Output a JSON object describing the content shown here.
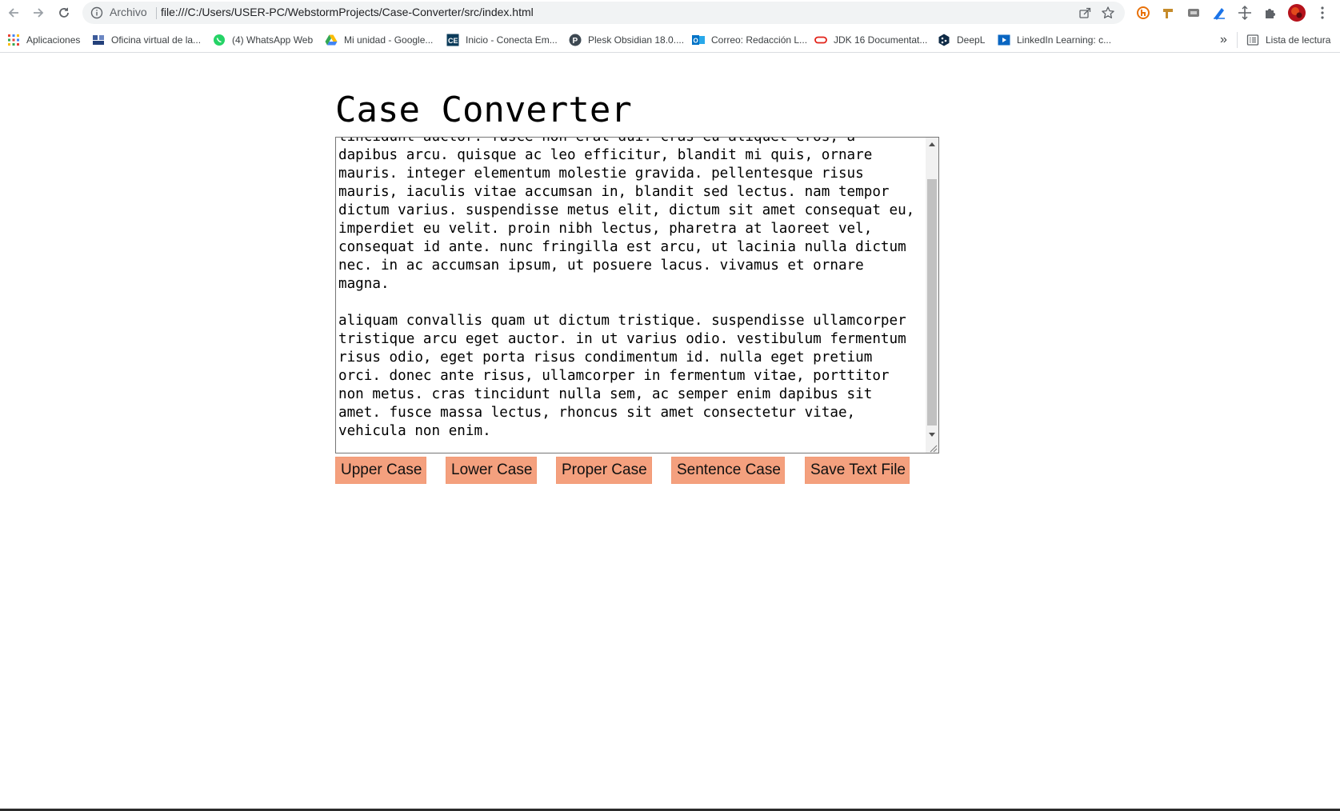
{
  "browser": {
    "scheme_label": "Archivo",
    "url": "file:///C:/Users/USER-PC/WebstormProjects/Case-Converter/src/index.html",
    "icons": [
      "back-icon",
      "forward-icon",
      "reload-icon",
      "info-icon",
      "share-icon",
      "star-icon",
      "extension-icons",
      "puzzle-icon",
      "profile-avatar",
      "menu-dots-icon"
    ]
  },
  "bookmarks": {
    "items": [
      {
        "label": "Aplicaciones",
        "icon": "apps-grid-icon"
      },
      {
        "label": "Oficina virtual de la...",
        "icon": "office-icon"
      },
      {
        "label": "(4) WhatsApp Web",
        "icon": "whatsapp-icon"
      },
      {
        "label": "Mi unidad - Google...",
        "icon": "google-drive-icon"
      },
      {
        "label": "Inicio - Conecta Em...",
        "icon": "ce-icon"
      },
      {
        "label": "Plesk Obsidian 18.0....",
        "icon": "plesk-icon"
      },
      {
        "label": "Correo: Redacción L...",
        "icon": "outlook-icon"
      },
      {
        "label": "JDK 16 Documentat...",
        "icon": "oracle-icon"
      },
      {
        "label": "DeepL",
        "icon": "deepl-icon"
      },
      {
        "label": "LinkedIn Learning: c...",
        "icon": "linkedin-learning-icon"
      }
    ],
    "overflow_label": "»",
    "reading_list_label": "Lista de lectura"
  },
  "page": {
    "title": "Case Converter",
    "text_content": "tincidunt auctor. fusce non erat dui. cras eu aliquet eros, a dapibus arcu. quisque ac leo efficitur, blandit mi quis, ornare mauris. integer elementum molestie gravida. pellentesque risus mauris, iaculis vitae accumsan in, blandit sed lectus. nam tempor dictum varius. suspendisse metus elit, dictum sit amet consequat eu, imperdiet eu velit. proin nibh lectus, pharetra at laoreet vel, consequat id ante. nunc fringilla est arcu, ut lacinia nulla dictum nec. in ac accumsan ipsum, ut posuere lacus. vivamus et ornare magna.\n\naliquam convallis quam ut dictum tristique. suspendisse ullamcorper tristique arcu eget auctor. in ut varius odio. vestibulum fermentum risus odio, eget porta risus condimentum id. nulla eget pretium orci. donec ante risus, ullamcorper in fermentum vitae, porttitor non metus. cras tincidunt nulla sem, ac semper enim dapibus sit amet. fusce massa lectus, rhoncus sit amet consectetur vitae, vehicula non enim.",
    "buttons": {
      "upper": "Upper Case",
      "lower": "Lower Case",
      "proper": "Proper Case",
      "sentence": "Sentence Case",
      "save": "Save Text File"
    },
    "button_color": "#f4a07e"
  }
}
